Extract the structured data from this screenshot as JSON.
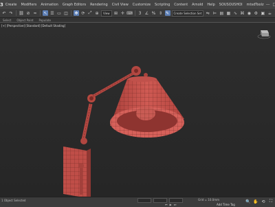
{
  "menu": {
    "logo": "3",
    "items": [
      "Create",
      "Modifiers",
      "Animation",
      "Graph Editors",
      "Rendering",
      "Civil View",
      "Customize",
      "Scripting",
      "Content",
      "Arnold",
      "Help",
      "SOUSOUSHOI",
      "mtsdToolz"
    ],
    "window_controls": [
      "—",
      "□",
      "✕"
    ]
  },
  "toolbar": {
    "view_dropdown": "View",
    "selection_set": "Create Selection Set"
  },
  "tabs": [
    "Select",
    "Object Paint",
    "Populate"
  ],
  "viewport": {
    "label": "[+] [Perspective] [Standard] [Default Shading]",
    "mesh_color": "#c14e49",
    "wire_color": "#5a1f1c"
  },
  "status": {
    "left_text": "1 Object Selected",
    "grid": "Grid = 10.0mm",
    "add_time_tag": "Add Time Tag"
  },
  "colors": {
    "accent": "#5d7fb5"
  }
}
